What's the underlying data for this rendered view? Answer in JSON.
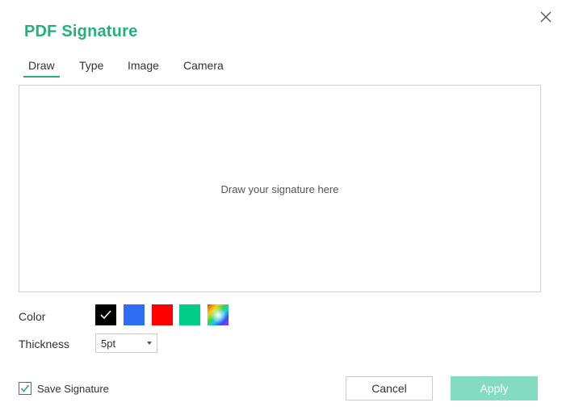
{
  "dialog": {
    "title": "PDF Signature",
    "close_icon": "close-icon"
  },
  "tabs": [
    {
      "label": "Draw",
      "active": true
    },
    {
      "label": "Type",
      "active": false
    },
    {
      "label": "Image",
      "active": false
    },
    {
      "label": "Camera",
      "active": false
    }
  ],
  "canvas": {
    "placeholder": "Draw your signature here"
  },
  "color": {
    "label": "Color",
    "swatches": [
      {
        "name": "black",
        "hex": "#000000",
        "selected": true
      },
      {
        "name": "blue",
        "hex": "#2f6df5",
        "selected": false
      },
      {
        "name": "red",
        "hex": "#ff0000",
        "selected": false
      },
      {
        "name": "green",
        "hex": "#00cc88",
        "selected": false
      },
      {
        "name": "custom-gradient",
        "hex": "gradient",
        "selected": false
      }
    ]
  },
  "thickness": {
    "label": "Thickness",
    "value": "5pt"
  },
  "save_signature": {
    "label": "Save Signature",
    "checked": true
  },
  "buttons": {
    "cancel": "Cancel",
    "apply": "Apply"
  },
  "accent_color": "#22b07d"
}
